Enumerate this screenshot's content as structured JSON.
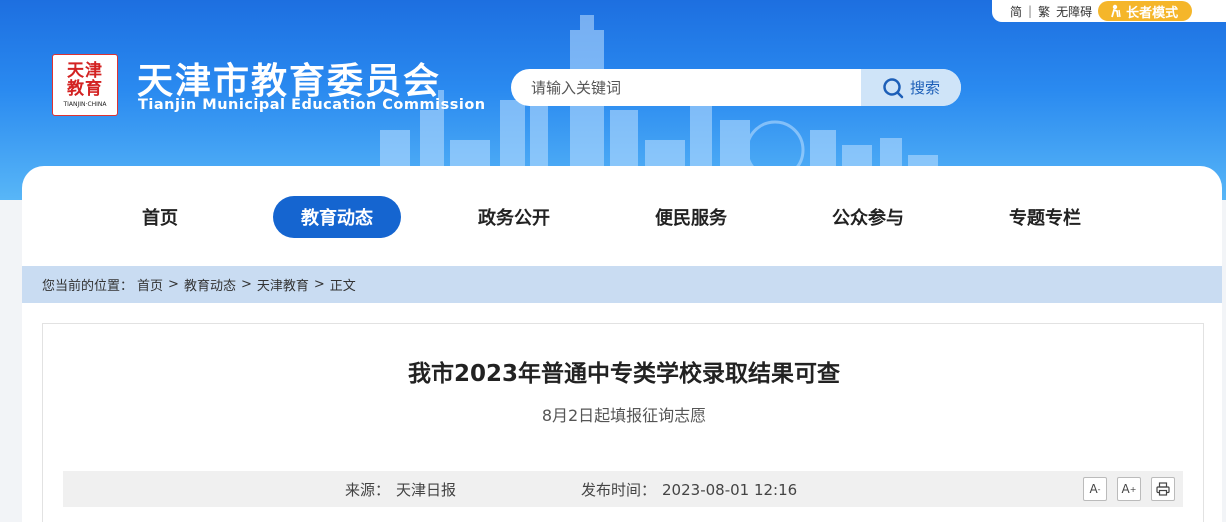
{
  "topbar": {
    "simplified": "简",
    "separator": "|",
    "traditional": "繁",
    "accessible": "无障碍",
    "elder_mode": "长者模式"
  },
  "header": {
    "logo": {
      "seal_text": "天津教育",
      "seal_en": "TIANJIN·CHINA"
    },
    "title": "天津市教育委员会",
    "subtitle": "Tianjin Municipal Education Commission"
  },
  "search": {
    "placeholder": "请输入关键词",
    "button_label": "搜索"
  },
  "nav": {
    "items": [
      {
        "label": "首页",
        "active": false
      },
      {
        "label": "教育动态",
        "active": true
      },
      {
        "label": "政务公开",
        "active": false
      },
      {
        "label": "便民服务",
        "active": false
      },
      {
        "label": "公众参与",
        "active": false
      },
      {
        "label": "专题专栏",
        "active": false
      }
    ]
  },
  "breadcrumb": {
    "prefix": "您当前的位置：",
    "items": [
      "首页",
      "教育动态",
      "天津教育",
      "正文"
    ],
    "separator": ">"
  },
  "article": {
    "title": "我市2023年普通中专类学校录取结果可查",
    "subtitle": "8月2日起填报征询志愿",
    "source_label": "来源：",
    "source": "天津日报",
    "time_label": "发布时间：",
    "time": "2023-08-01 12:16"
  },
  "tools": {
    "font_smaller": "A",
    "font_larger": "A",
    "font_smaller_mark": "-",
    "font_larger_mark": "+"
  },
  "colors": {
    "banner_top": "#1d6fe0",
    "nav_active": "#1565d0",
    "elder_button": "#f5b62a",
    "breadcrumb_bar": "#c9dcf2"
  }
}
